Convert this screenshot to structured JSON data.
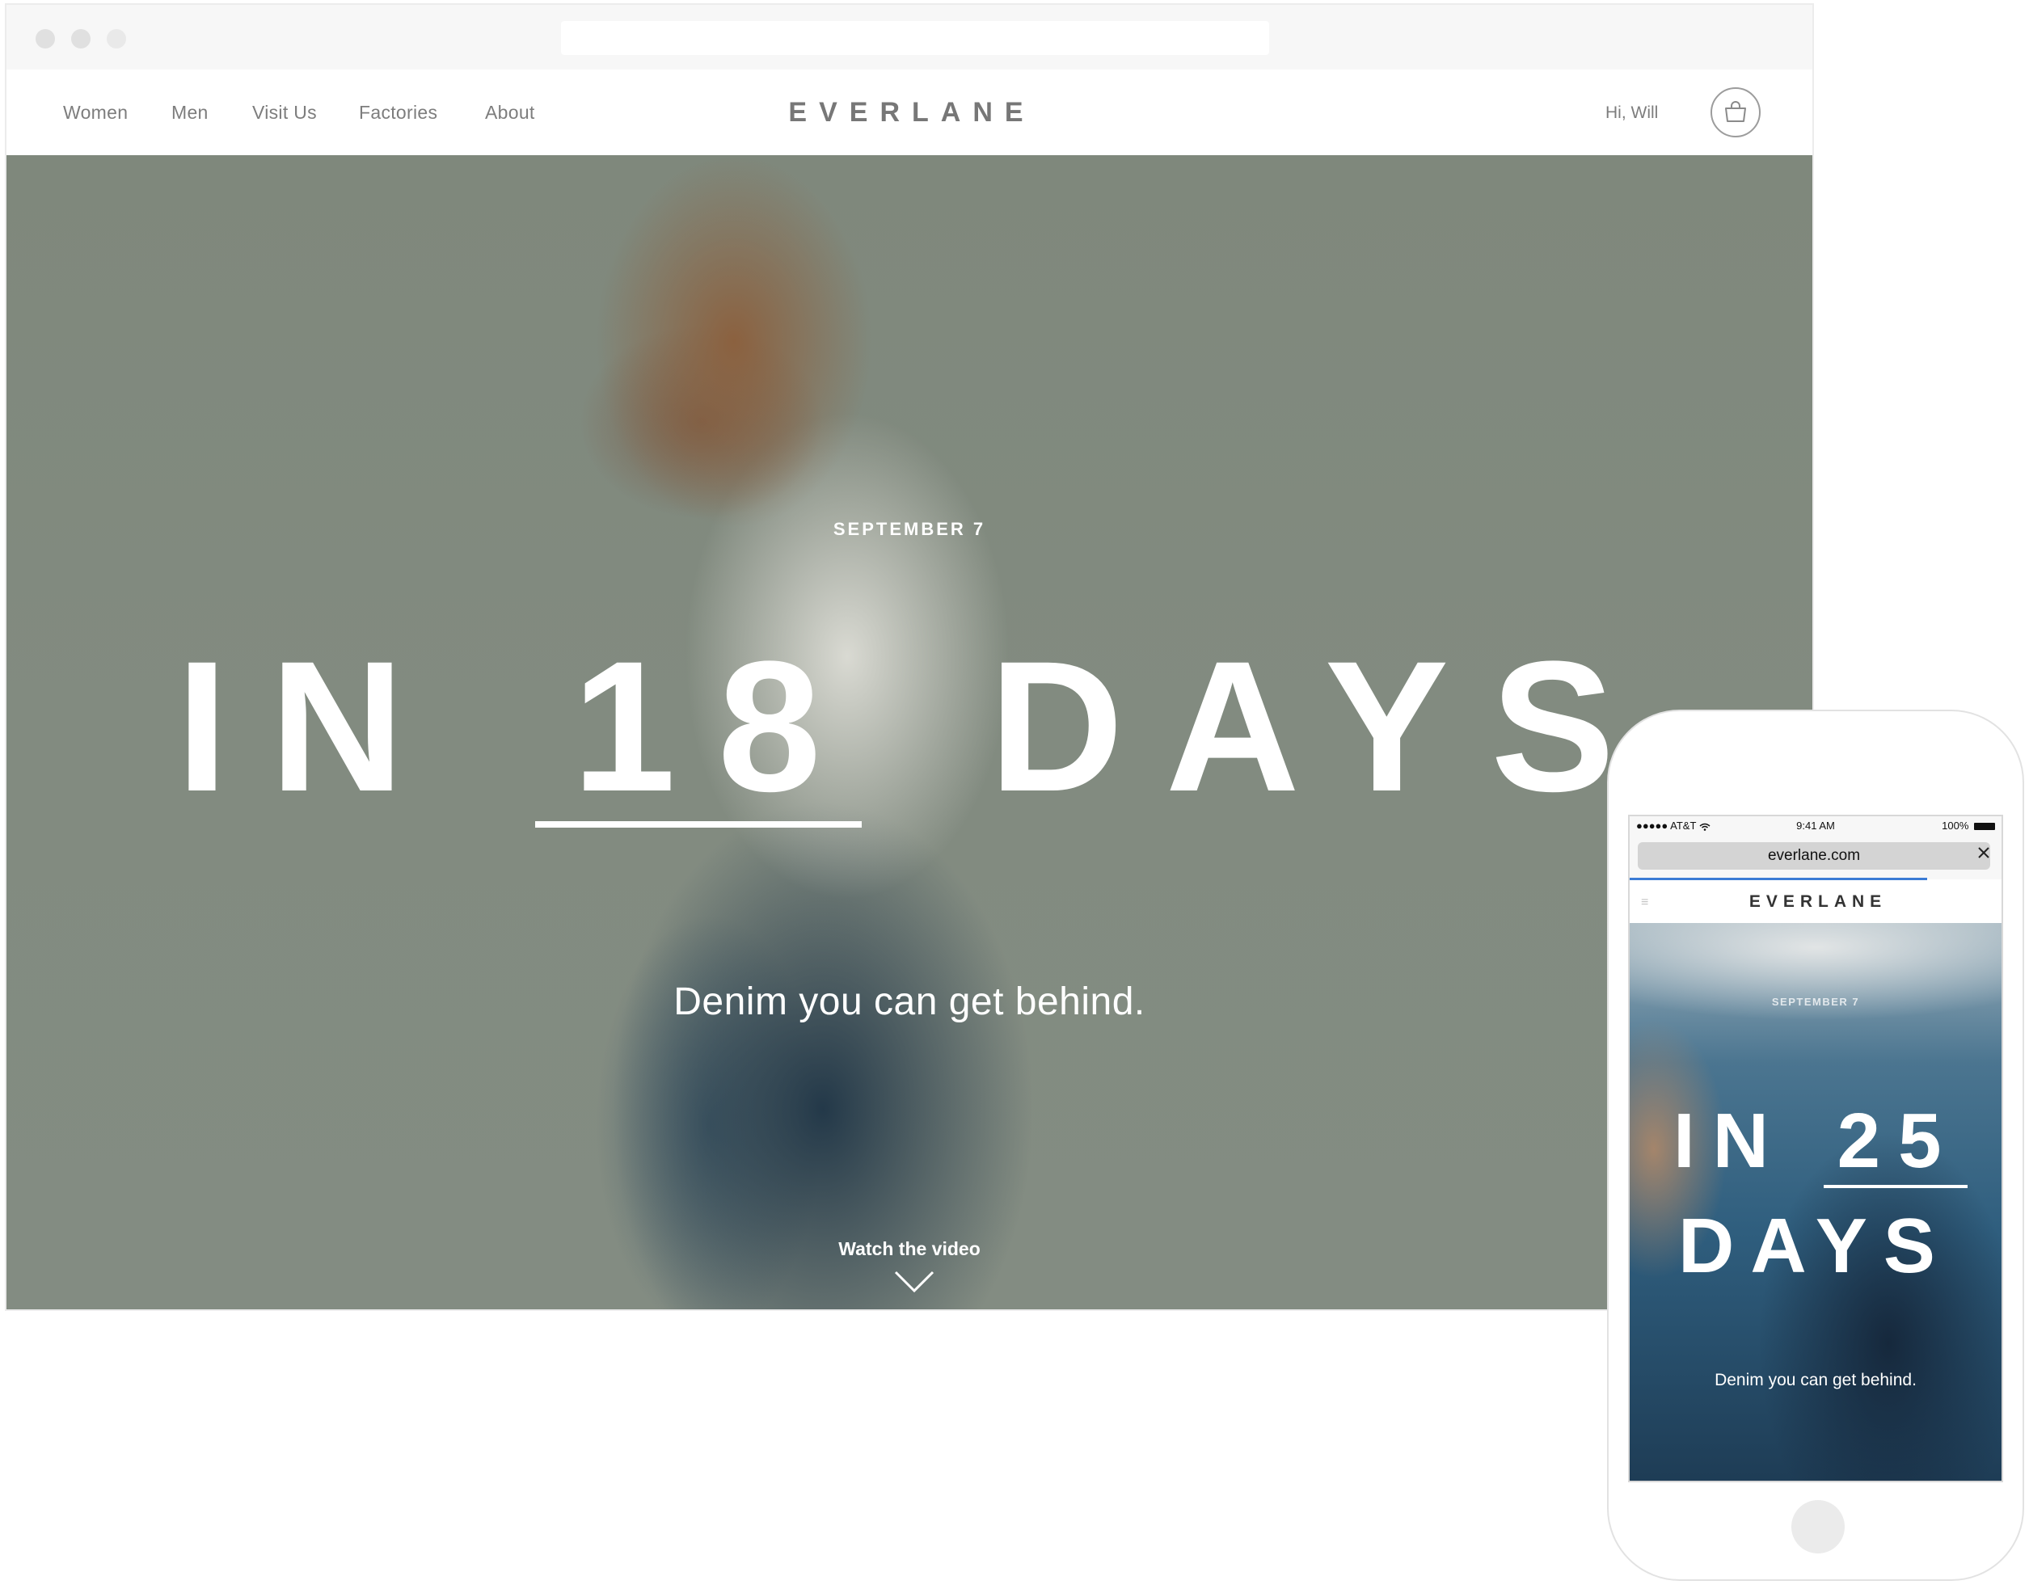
{
  "desktop": {
    "nav": {
      "links": [
        "Women",
        "Men",
        "Visit Us",
        "Factories",
        "About"
      ],
      "logo": "EVERLANE",
      "greeting": "Hi, Will",
      "cart_icon": "bag-icon"
    },
    "hero": {
      "date": "SEPTEMBER 7",
      "countdown_prefix": "IN",
      "countdown_number": "18",
      "countdown_suffix": "DAYS",
      "tagline": "Denim you can get behind.",
      "watch_label": "Watch the video",
      "watch_icon": "chevron-down-icon"
    }
  },
  "mobile": {
    "status": {
      "carrier": "●●●●● AT&T",
      "time": "9:41 AM",
      "battery": "100%"
    },
    "url": "everlane.com",
    "load_progress": 0.8,
    "logo": "EVERLANE",
    "hero": {
      "date": "SEPTEMBER 7",
      "countdown_prefix": "IN",
      "countdown_number": "25",
      "countdown_suffix": "DAYS",
      "tagline": "Denim you can get behind."
    }
  },
  "colors": {
    "nav_text": "#7d7d7d",
    "logo": "#777777",
    "hero_bg": "#828b80",
    "mobile_progress": "#3a7bd5"
  }
}
